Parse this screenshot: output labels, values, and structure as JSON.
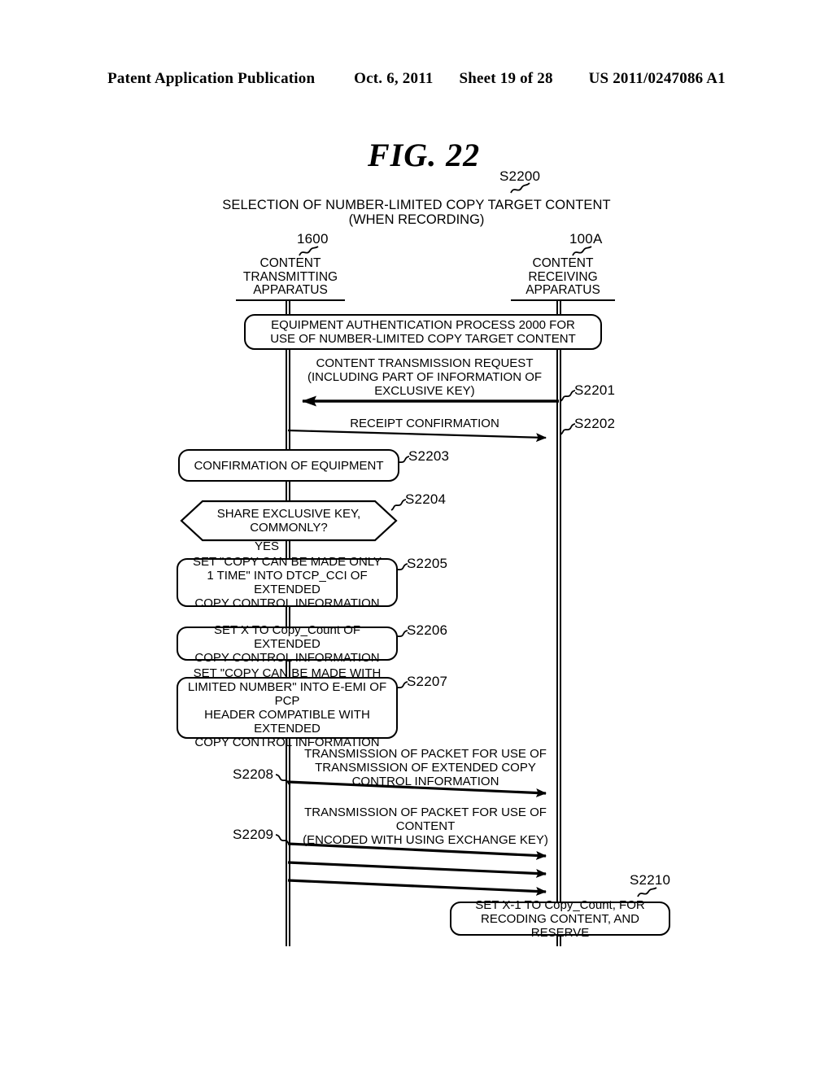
{
  "page_header": {
    "publication": "Patent Application Publication",
    "date": "Oct. 6, 2011",
    "sheet": "Sheet 19 of 28",
    "number": "US 2011/0247086 A1"
  },
  "figure": {
    "label": "FIG.  22",
    "title_line1": "SELECTION OF NUMBER-LIMITED COPY TARGET CONTENT",
    "title_line2": "(WHEN RECORDING)",
    "title_ref": "S2200"
  },
  "actors": [
    {
      "ref": "1600",
      "name_lines": "CONTENT\nTRANSMITTING\nAPPARATUS",
      "line1": "CONTENT",
      "line2": "TRANSMITTING",
      "line3": "APPARATUS"
    },
    {
      "ref": "100A",
      "name_lines": "CONTENT\nRECEIVING\nAPPARATUS",
      "line1": "CONTENT",
      "line2": "RECEIVING",
      "line3": "APPARATUS"
    }
  ],
  "steps": {
    "auth": {
      "text": "EQUIPMENT AUTHENTICATION PROCESS 2000 FOR\nUSE OF NUMBER-LIMITED COPY TARGET CONTENT"
    },
    "s2201": {
      "ref": "S2201",
      "text": "CONTENT TRANSMISSION REQUEST\n(INCLUDING PART OF INFORMATION OF\nEXCLUSIVE KEY)",
      "direction": "right-to-left"
    },
    "s2202": {
      "ref": "S2202",
      "text": "RECEIPT CONFIRMATION",
      "direction": "left-to-right"
    },
    "s2203": {
      "ref": "S2203",
      "text": "CONFIRMATION OF EQUIPMENT"
    },
    "s2204": {
      "ref": "S2204",
      "text": "SHARE EXCLUSIVE KEY,\nCOMMONLY?",
      "branch_label": "YES"
    },
    "s2205": {
      "ref": "S2205",
      "text": "SET \"COPY CAN BE MADE ONLY\n1 TIME\" INTO DTCP_CCI OF EXTENDED\nCOPY CONTROL INFORMATION"
    },
    "s2206": {
      "ref": "S2206",
      "text": "SET X TO Copy_Count OF EXTENDED\nCOPY CONTROL INFORMATION"
    },
    "s2207": {
      "ref": "S2207",
      "text": "SET \"COPY CAN BE MADE WITH\nLIMITED NUMBER\" INTO E-EMI OF PCP\nHEADER COMPATIBLE WITH EXTENDED\nCOPY CONTROL INFORMATION"
    },
    "s2208": {
      "ref": "S2208",
      "text": "TRANSMISSION OF PACKET FOR USE OF\nTRANSMISSION OF EXTENDED COPY\nCONTROL INFORMATION",
      "direction": "left-to-right"
    },
    "s2209": {
      "ref": "S2209",
      "text": "TRANSMISSION OF PACKET FOR USE OF\nCONTENT\n(ENCODED WITH USING EXCHANGE KEY)",
      "direction": "left-to-right",
      "arrow_count": 3
    },
    "s2210": {
      "ref": "S2210",
      "text": "SET X-1 TO Copy_Count, FOR\nRECODING CONTENT, AND RESERVE"
    }
  },
  "colors": {
    "ink": "#000000",
    "paper": "#ffffff"
  }
}
